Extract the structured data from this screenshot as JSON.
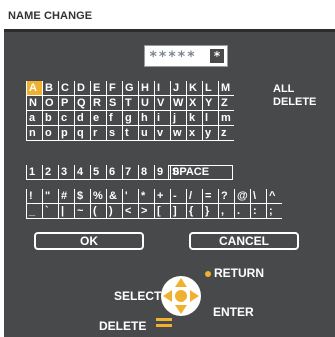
{
  "title": "NAME CHANGE",
  "name_value": "*****",
  "cursor_char": "*",
  "rows": [
    [
      "A",
      "B",
      "C",
      "D",
      "E",
      "F",
      "G",
      "H",
      "I",
      "J",
      "K",
      "L",
      "M"
    ],
    [
      "N",
      "O",
      "P",
      "Q",
      "R",
      "S",
      "T",
      "U",
      "V",
      "W",
      "X",
      "Y",
      "Z"
    ],
    [
      "a",
      "b",
      "c",
      "d",
      "e",
      "f",
      "g",
      "h",
      "i",
      "j",
      "k",
      "l",
      "m"
    ],
    [
      "n",
      "o",
      "p",
      "q",
      "r",
      "s",
      "t",
      "u",
      "v",
      "w",
      "x",
      "y",
      "z"
    ],
    [
      "1",
      "2",
      "3",
      "4",
      "5",
      "6",
      "7",
      "8",
      "9",
      "0"
    ],
    [
      "!",
      "\"",
      "#",
      "$",
      "%",
      "&",
      "'",
      "*",
      "+",
      "-",
      "/",
      "=",
      "?",
      "@",
      "\\",
      "^"
    ],
    [
      "_",
      "`",
      "|",
      "~",
      "(",
      ")",
      "<",
      ">",
      "[",
      "]",
      "{",
      "}",
      ",",
      ".",
      ":",
      ";"
    ]
  ],
  "space_label": "SPACE",
  "all_delete_label": "ALL DELETE",
  "ok_label": "OK",
  "cancel_label": "CANCEL",
  "legend": {
    "select": "SELECT",
    "return": "RETURN",
    "enter": "ENTER",
    "delete": "DELETE"
  },
  "colors": {
    "panel": "#47494a",
    "accent": "#f0b030"
  },
  "selected_char": "A"
}
